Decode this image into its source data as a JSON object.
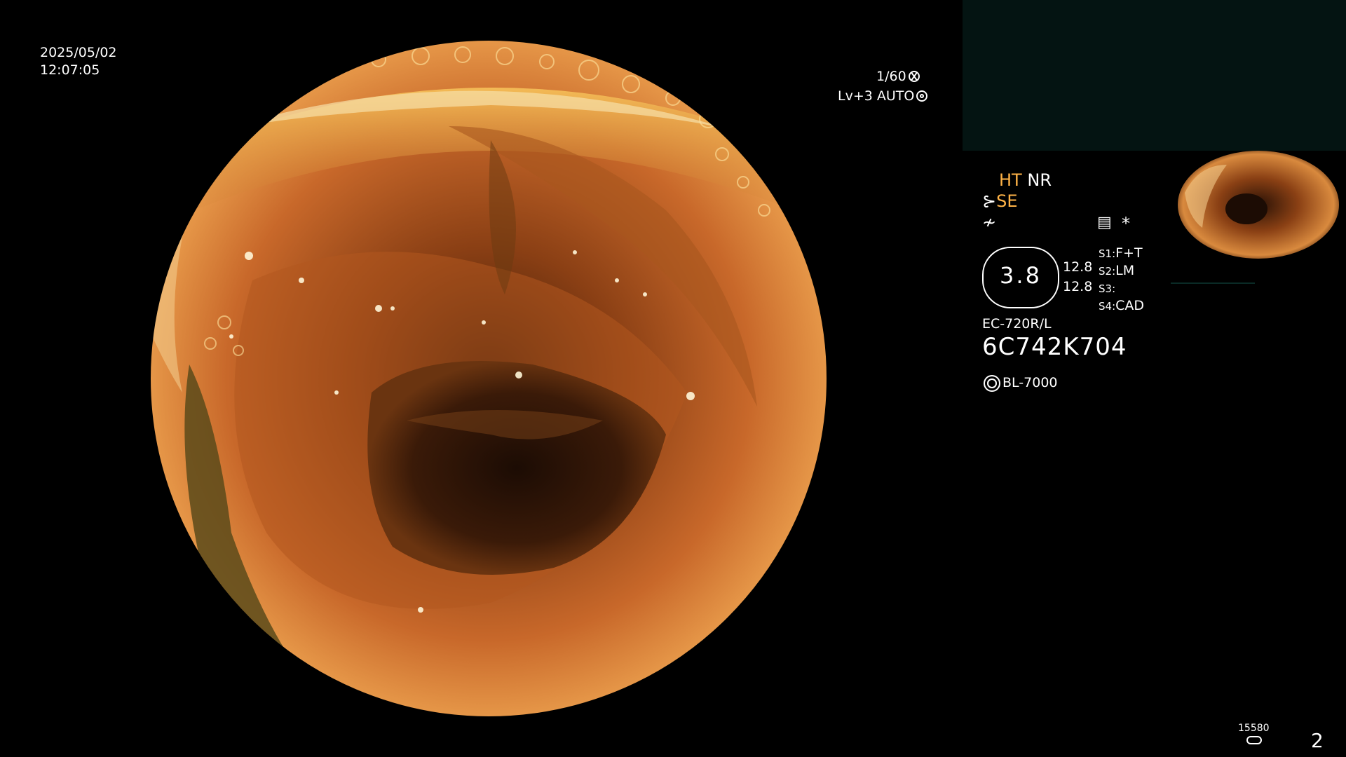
{
  "overlay": {
    "date": "2025/05/02",
    "time": "12:07:05",
    "shutter": "1/60",
    "level_mode": "Lv+3 AUTO",
    "mode_ht": "HT",
    "mode_nr": "NR",
    "mode_se": "SE",
    "asterisk": "*",
    "gauge_value": "3.8",
    "metric_a": "12.8",
    "metric_b": "12.8",
    "s1_label": "S1:",
    "s1_value": "F+T",
    "s2_label": "S2:",
    "s2_value": "LM",
    "s3_label": "S3:",
    "s4_label": "S4:",
    "s4_value": "CAD",
    "scope_model": "EC-720R/L",
    "scope_serial": "6C742K704",
    "light_source": "BL-7000",
    "frame_counter": "15580",
    "page_number": "2"
  },
  "colors": {
    "background": "#000000",
    "overlay_text": "#ffffff",
    "highlight": "#ffb347",
    "panel": "#041412"
  },
  "icons": [
    "aperture-icon",
    "iris-icon",
    "scope-icon",
    "freeze-icon",
    "menu-icon",
    "light-icon",
    "disk-icon"
  ]
}
